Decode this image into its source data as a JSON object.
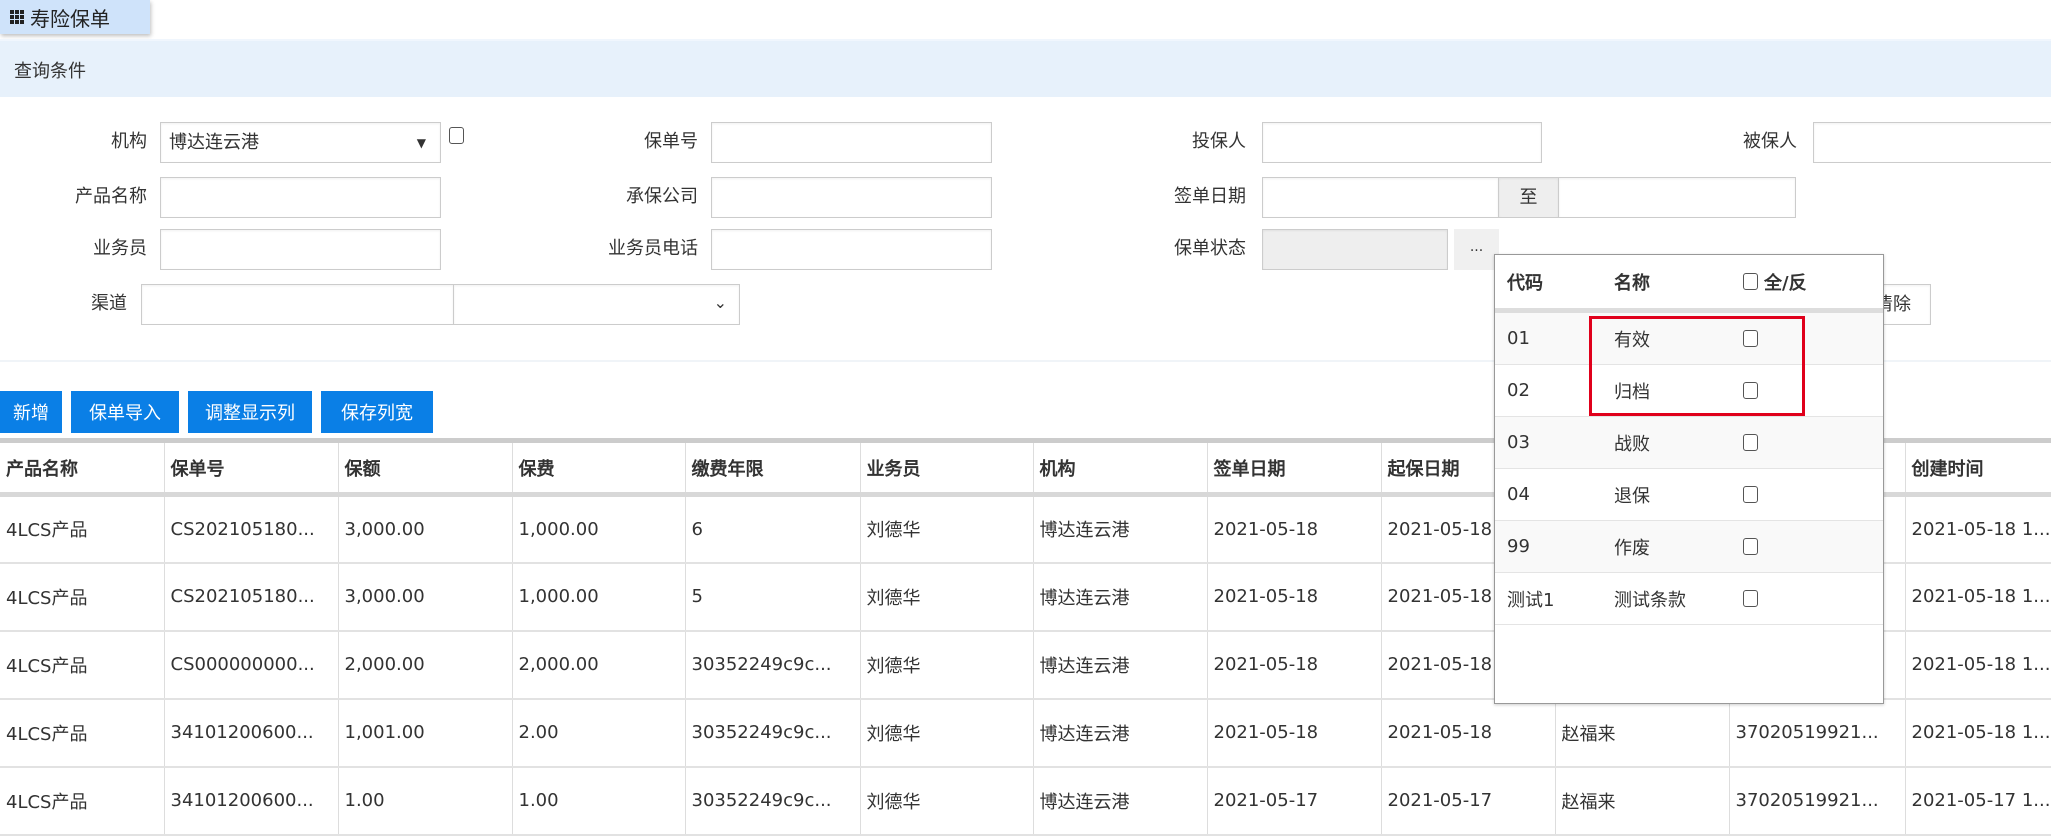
{
  "tab": {
    "title": "寿险保单",
    "icon": "grid-icon"
  },
  "query": {
    "title": "查询条件",
    "org_label": "机构",
    "org_value": "博达连云港",
    "policy_no_label": "保单号",
    "applicant_label": "投保人",
    "insured_label": "被保人",
    "product_label": "产品名称",
    "insurer_label": "承保公司",
    "sign_date_label": "签单日期",
    "to_label": "至",
    "agent_label": "业务员",
    "agent_phone_label": "业务员电话",
    "status_label": "保单状态",
    "status_btn": "...",
    "channel_label": "渠道",
    "clear_btn": "清除"
  },
  "toolbar": {
    "add": "新增",
    "import": "保单导入",
    "columns": "调整显示列",
    "save_width": "保存列宽"
  },
  "table": {
    "headers": [
      "产品名称",
      "保单号",
      "保额",
      "保费",
      "缴费年限",
      "业务员",
      "机构",
      "签单日期",
      "起保日期",
      "",
      "",
      "创建时间"
    ],
    "rows": [
      [
        "4LCS产品",
        "CS202105180...",
        "3,000.00",
        "1,000.00",
        "6",
        "刘德华",
        "博达连云港",
        "2021-05-18",
        "2021-05-18",
        "",
        "",
        "2021-05-18 1..."
      ],
      [
        "4LCS产品",
        "CS202105180...",
        "3,000.00",
        "1,000.00",
        "5",
        "刘德华",
        "博达连云港",
        "2021-05-18",
        "2021-05-18",
        "",
        "",
        "2021-05-18 1..."
      ],
      [
        "4LCS产品",
        "CS000000000...",
        "2,000.00",
        "2,000.00",
        "30352249c9c...",
        "刘德华",
        "博达连云港",
        "2021-05-18",
        "2021-05-18",
        "",
        "",
        "2021-05-18 1..."
      ],
      [
        "4LCS产品",
        "34101200600...",
        "1,001.00",
        "2.00",
        "30352249c9c...",
        "刘德华",
        "博达连云港",
        "2021-05-18",
        "2021-05-18",
        "赵福来",
        "37020519921...",
        "2021-05-18 1..."
      ],
      [
        "4LCS产品",
        "34101200600...",
        "1.00",
        "1.00",
        "30352249c9c...",
        "刘德华",
        "博达连云港",
        "2021-05-17",
        "2021-05-17",
        "赵福来",
        "37020519921...",
        "2021-05-17 1..."
      ]
    ]
  },
  "status_popup": {
    "col_code": "代码",
    "col_name": "名称",
    "col_all": "全/反",
    "items": [
      {
        "code": "01",
        "name": "有效"
      },
      {
        "code": "02",
        "name": "归档"
      },
      {
        "code": "03",
        "name": "战败"
      },
      {
        "code": "04",
        "name": "退保"
      },
      {
        "code": "99",
        "name": "作废"
      },
      {
        "code": "测试1",
        "name": "测试条款"
      }
    ]
  },
  "colors": {
    "accent": "#0a7fe6",
    "highlight": "#e0001b"
  }
}
